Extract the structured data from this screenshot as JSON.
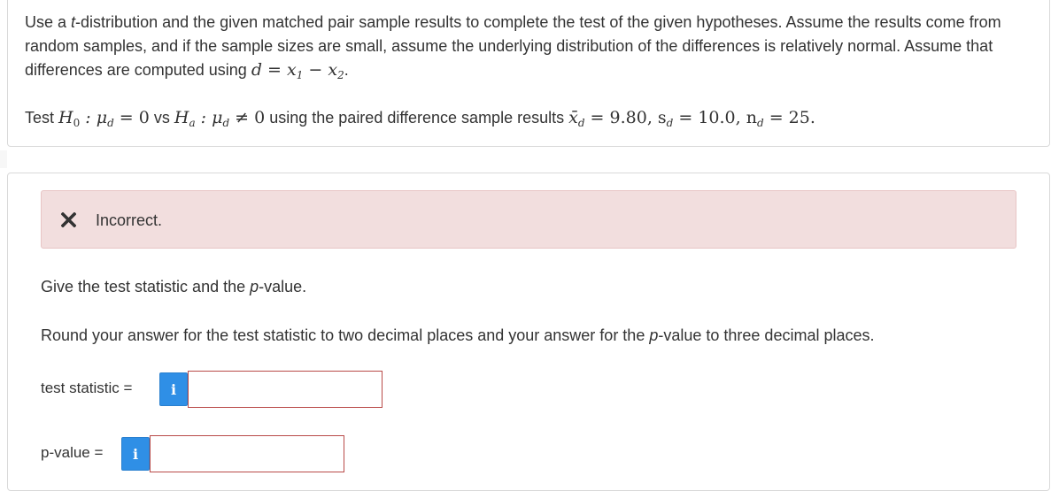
{
  "question": {
    "intro_a": "Use a ",
    "intro_t": "t",
    "intro_b": "-distribution and the given matched pair sample results to complete the test of the given hypotheses. Assume the results come from random samples, and if the sample sizes are small, assume the underlying distribution of the differences is relatively normal. Assume that differences are computed using ",
    "diff_formula": "d = x",
    "sub_1": "1",
    "minus": " − x",
    "sub_2": "2",
    "period": ".",
    "test_word": "Test ",
    "h0_H": "H",
    "h0_sub": "0",
    "h0_rest": " : μ",
    "h0_mu_sub": "d",
    "h0_value": " = 0",
    "vs_word": " vs ",
    "ha_H": "H",
    "ha_sub": "a",
    "ha_rest": " : μ",
    "ha_mu_sub": "d",
    "ha_value": " ≠ 0",
    "using_text": " using the paired difference sample results ",
    "xbar": "x̄",
    "xbar_sub": "d",
    "xbar_value": " = 9.80, s",
    "s_sub": "d",
    "s_value": " = 10.0, n",
    "n_sub": "d",
    "n_value": " = 25."
  },
  "feedback": {
    "status_text": "Incorrect.",
    "icon": "x-mark-icon",
    "color": "#f2dede",
    "icon_color": "#333333"
  },
  "instructions": {
    "line1_a": "Give the test statistic and the ",
    "line1_p": "p",
    "line1_b": "-value.",
    "line2_a": "Round your answer for the test statistic to two decimal places and your answer for the ",
    "line2_p": "p",
    "line2_b": "-value to three decimal places."
  },
  "fields": {
    "test_statistic": {
      "label": "test statistic =",
      "info_glyph": "i",
      "value": ""
    },
    "p_value": {
      "label": "p-value =",
      "info_glyph": "i",
      "value": ""
    }
  },
  "colors": {
    "info_button": "#2f8fe6",
    "input_error_border": "#b94a48",
    "text": "#333333"
  }
}
